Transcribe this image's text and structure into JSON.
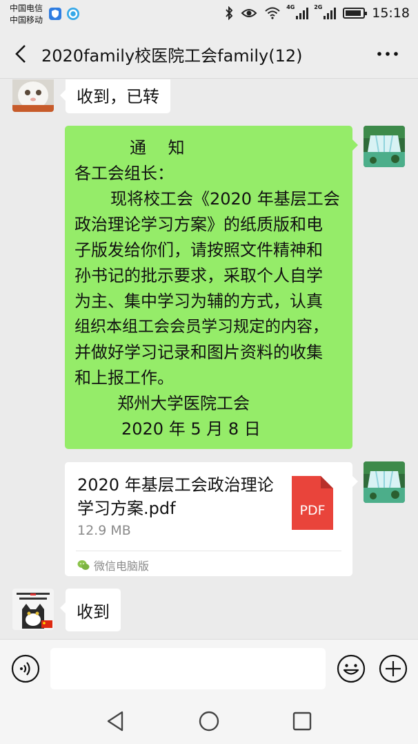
{
  "status_bar": {
    "carrier_1": "中国电信",
    "carrier_2": "中国移动",
    "network_1": "4G",
    "network_2": "2G",
    "time": "15:18"
  },
  "header": {
    "title": "2020family校医院工会family(12)",
    "back_icon": "chevron-left-icon",
    "more_icon": "more-dots-icon"
  },
  "messages": [
    {
      "side": "left",
      "type": "text",
      "text": "收到，已转"
    },
    {
      "side": "right",
      "type": "text",
      "lines": [
        "通　 知",
        "各工会组长：",
        "现将校工会《2020 年基层工会",
        "政治理论学习方案》的纸质版和电",
        "子版发给你们，请按照文件精神和",
        "孙书记的批示要求，采取个人自学",
        "为主、集中学习为辅的方式，认真",
        "组织本组工会会员学习规定的内容，",
        "并做好学习记录和图片资料的收集",
        "和上报工作。",
        "郑州大学医院工会",
        "2020 年 5 月 8 日"
      ]
    },
    {
      "side": "right",
      "type": "file",
      "file_name": "2020 年基层工会政治理论学习方案.pdf",
      "file_size": "12.9 MB",
      "file_badge": "PDF",
      "source": "微信电脑版"
    },
    {
      "side": "left",
      "type": "text",
      "text": "收到"
    }
  ],
  "input_bar": {
    "voice_icon": "voice-icon",
    "emoji_icon": "emoji-icon",
    "plus_icon": "plus-icon",
    "text_value": ""
  },
  "nav_bar": {
    "back_icon": "triangle-back-icon",
    "home_icon": "circle-home-icon",
    "recents_icon": "square-recents-icon"
  },
  "colors": {
    "sent_bubble": "#95ec69",
    "received_bubble": "#ffffff",
    "chat_background": "#ebebeb",
    "pdf_red": "#e9443b"
  }
}
